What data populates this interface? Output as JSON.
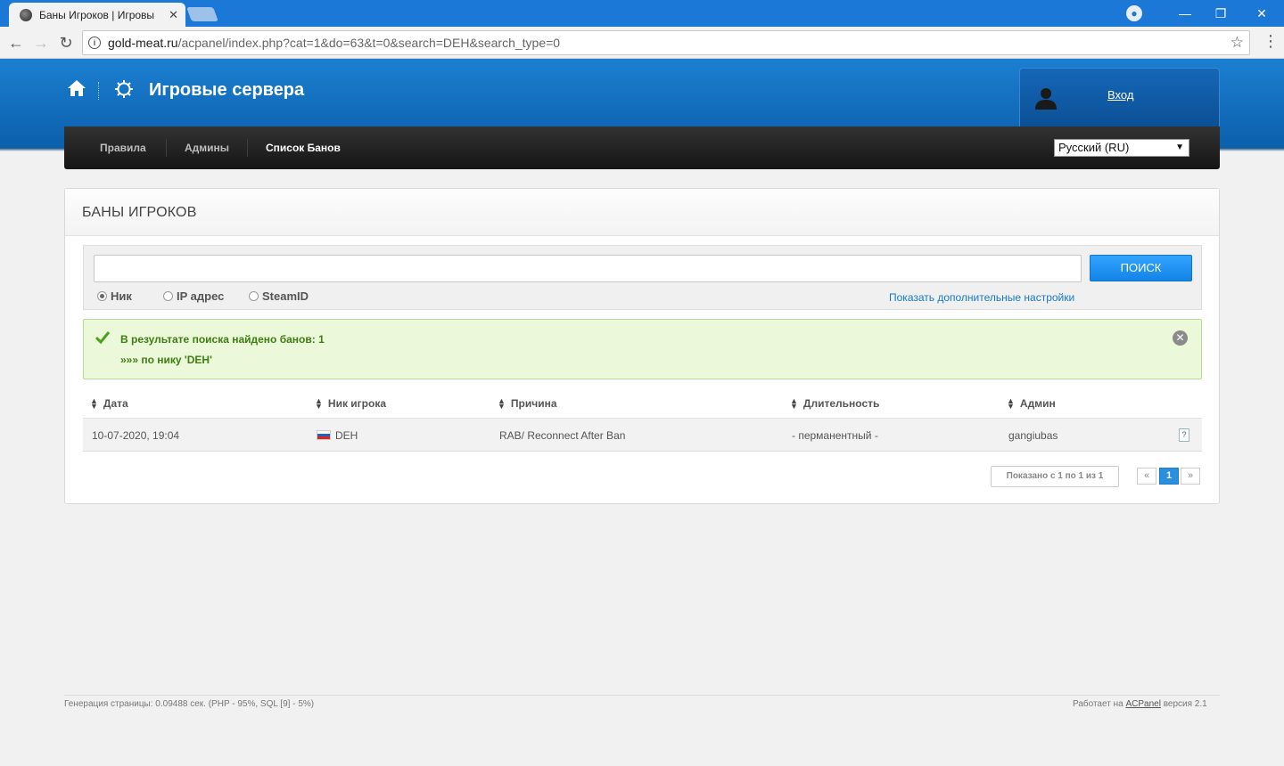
{
  "browser": {
    "tab_title": "Баны Игроков | Игровы",
    "url_host": "gold-meat.ru",
    "url_path": "/acpanel/index.php?cat=1&do=63&t=0&search=DEH&search_type=0"
  },
  "header": {
    "site_title": "Игровые сервера",
    "login_label": "Вход"
  },
  "nav": {
    "items": [
      {
        "label": "Правила"
      },
      {
        "label": "Админы"
      },
      {
        "label": "Список Банов"
      }
    ],
    "language": "Русский (RU)"
  },
  "panel": {
    "title": "БАНЫ ИГРОКОВ",
    "search": {
      "button_label": "ПОИСК",
      "value": "",
      "options": [
        {
          "label": "Ник",
          "selected": true
        },
        {
          "label": "IP адрес",
          "selected": false
        },
        {
          "label": "SteamID",
          "selected": false
        }
      ],
      "advanced_link": "Показать дополнительные настройки"
    },
    "alert": {
      "line1": "В результате поиска найдено банов: 1",
      "line2": "»»» по нику 'DEH'"
    },
    "table": {
      "columns": [
        "Дата",
        "Ник игрока",
        "Причина",
        "Длительность",
        "Админ"
      ],
      "rows": [
        {
          "date": "10-07-2020, 19:04",
          "nick": "DEH",
          "reason": "RAB/ Reconnect After Ban",
          "duration": "- перманентный -",
          "admin": "gangiubas",
          "flag": "ru"
        }
      ]
    },
    "pager": {
      "info": "Показано с 1 по 1 из 1",
      "prev": "«",
      "current": "1",
      "next": "»"
    }
  },
  "footer": {
    "generation": "Генерация страницы: 0.09488 сек. (PHP - 95%, SQL [9] - 5%)",
    "powered_prefix": "Работает на ",
    "powered_link": "ACPanel",
    "powered_suffix": " версия 2.1"
  },
  "colors": {
    "header_blue": "#0b5fab",
    "accent_button": "#1384e6",
    "success_bg": "#ebf8d9",
    "success_text": "#3f7e12"
  }
}
